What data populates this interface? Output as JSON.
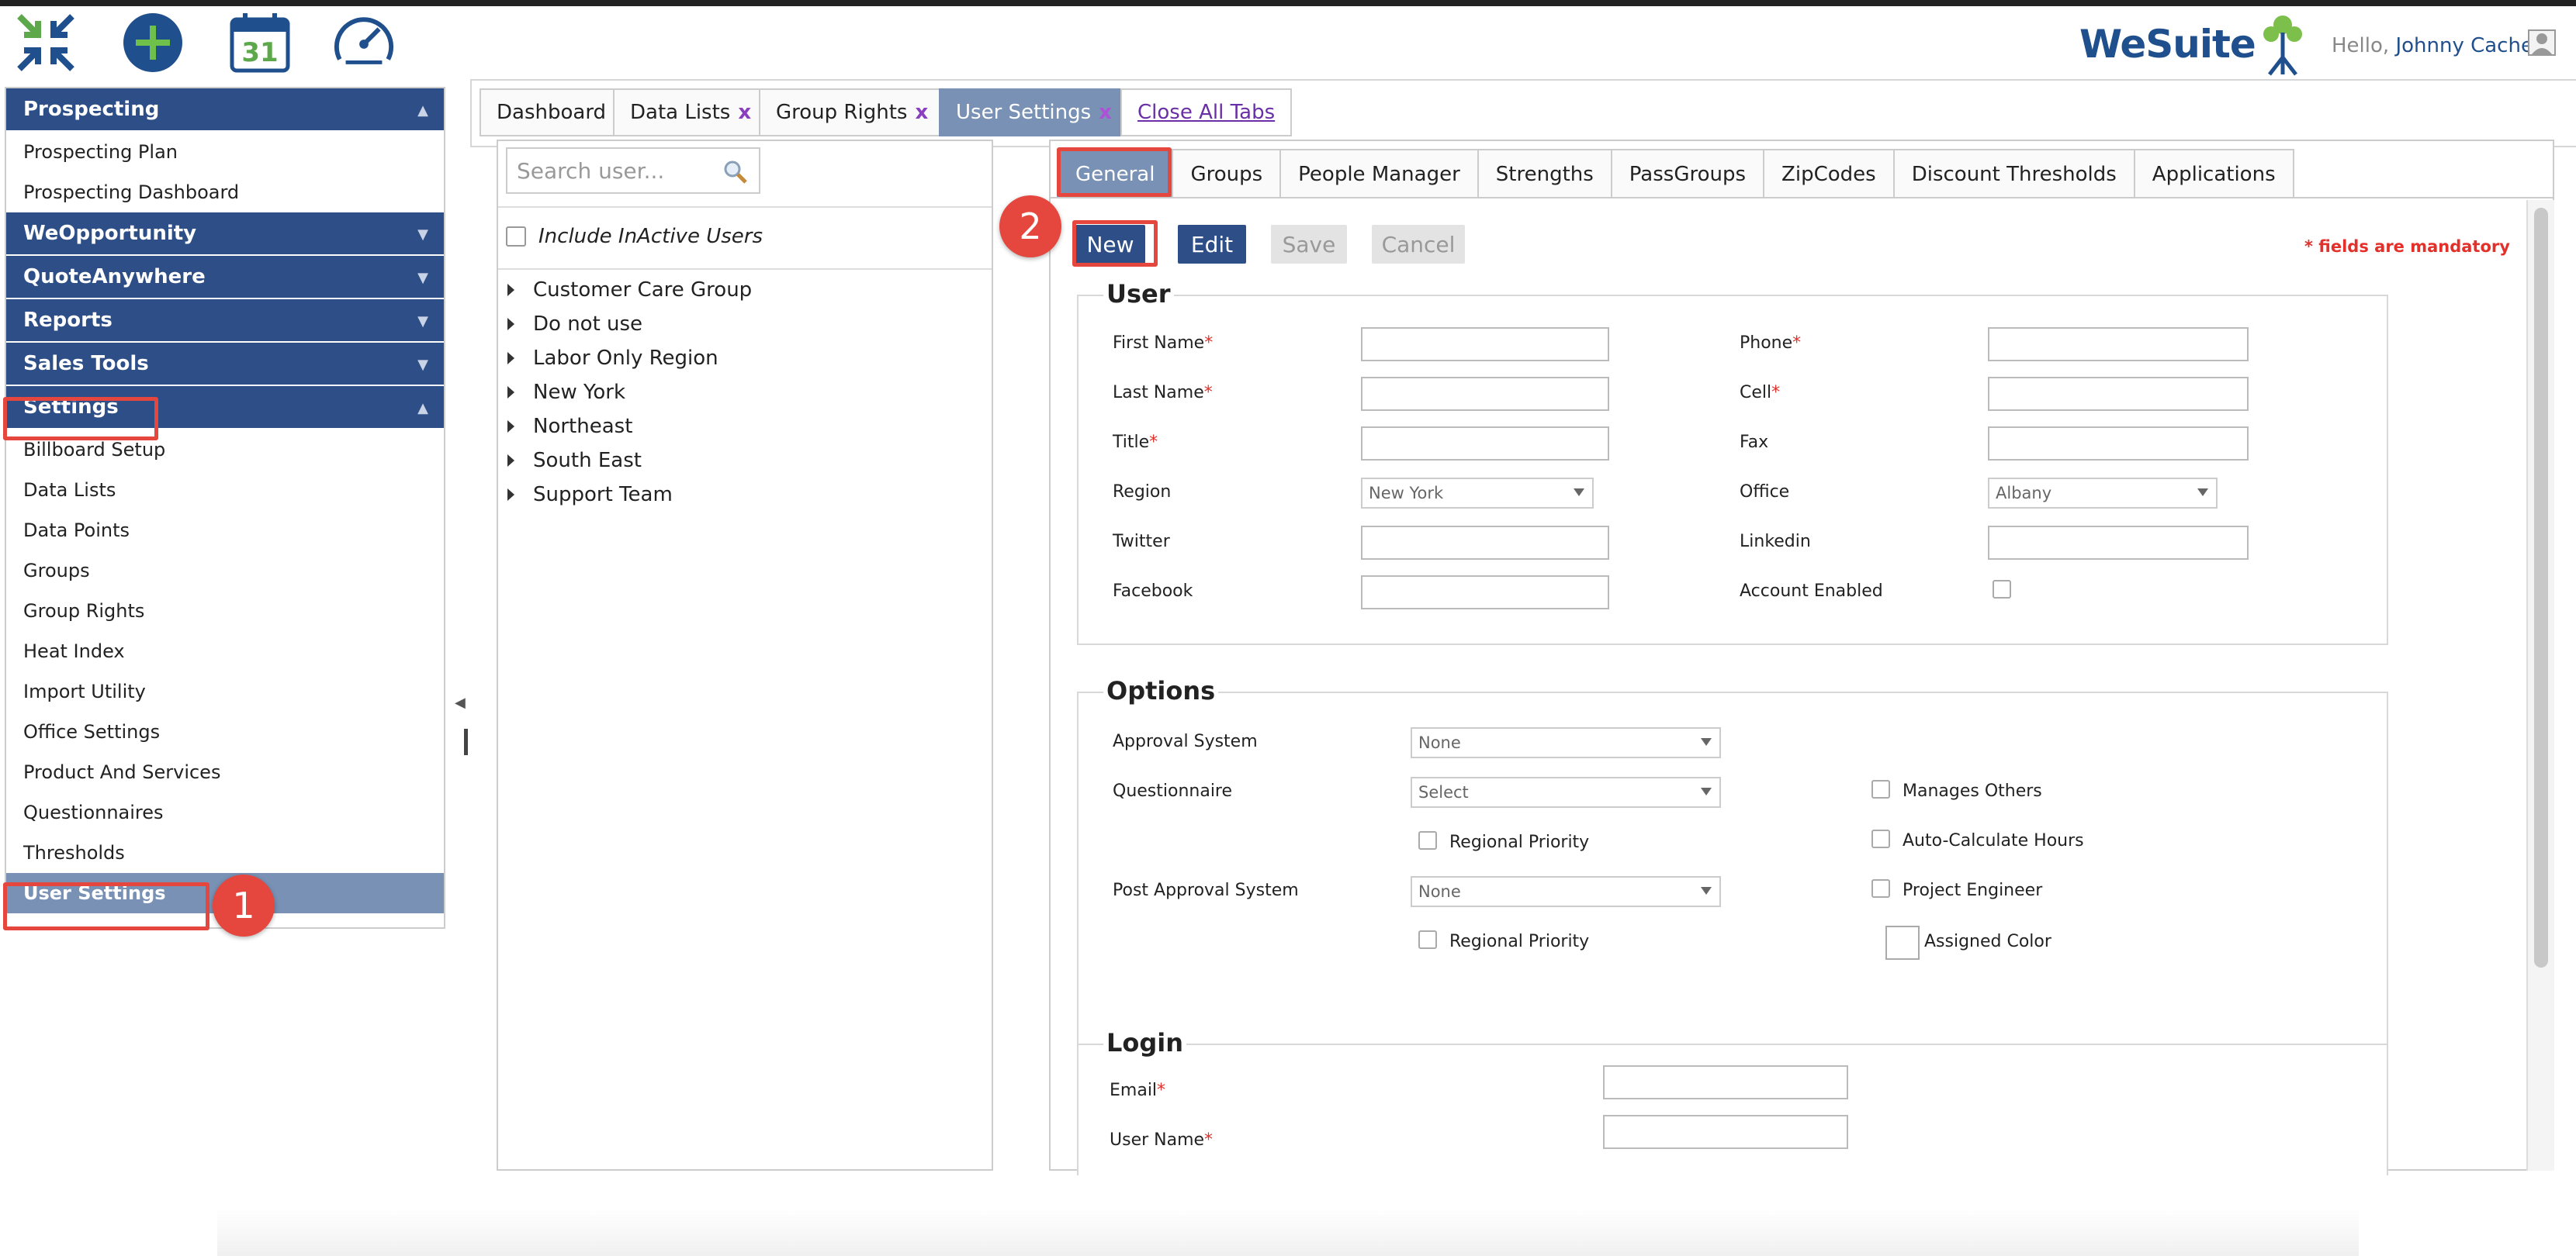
{
  "header": {
    "icons": [
      "collapse-arrows-icon",
      "add-circle-icon",
      "calendar-icon",
      "speedometer-icon"
    ],
    "calendar_day": "31",
    "brand": "WeSuite",
    "greeting": "Hello,",
    "user_name": "Johnny Cache"
  },
  "sidebar": {
    "sections": [
      {
        "label": "Prospecting",
        "items": [
          "Prospecting Plan",
          "Prospecting Dashboard"
        ]
      },
      {
        "label": "WeOpportunity",
        "items": []
      },
      {
        "label": "QuoteAnywhere",
        "items": []
      },
      {
        "label": "Reports",
        "items": []
      },
      {
        "label": "Sales Tools",
        "items": []
      },
      {
        "label": "Settings",
        "items": [
          "Billboard Setup",
          "Data Lists",
          "Data Points",
          "Groups",
          "Group Rights",
          "Heat Index",
          "Import Utility",
          "Office Settings",
          "Product And Services",
          "Questionnaires",
          "Thresholds",
          "User Settings"
        ]
      }
    ]
  },
  "annotations": {
    "step1": "1",
    "step2": "2"
  },
  "tabs": {
    "items": [
      "Dashboard",
      "Data Lists",
      "Group Rights",
      "User Settings"
    ],
    "close_mark": "x",
    "close_all": "Close All Tabs"
  },
  "userlist": {
    "search_placeholder": "Search user...",
    "include_inactive": "Include InActive Users",
    "groups": [
      "Customer Care Group",
      "Do not use",
      "Labor Only Region",
      "New York",
      "Northeast",
      "South East",
      "Support Team"
    ]
  },
  "subtabs": [
    "General",
    "Groups",
    "People Manager",
    "Strengths",
    "PassGroups",
    "ZipCodes",
    "Discount Thresholds",
    "Applications"
  ],
  "actions": {
    "new": "New",
    "edit": "Edit",
    "save": "Save",
    "cancel": "Cancel"
  },
  "mandatory_note": "* fields are mandatory",
  "user_section": {
    "legend": "User",
    "first_name": "First Name",
    "last_name": "Last Name",
    "title": "Title",
    "region": "Region",
    "region_value": "New York",
    "twitter": "Twitter",
    "facebook": "Facebook",
    "phone": "Phone",
    "cell": "Cell",
    "fax": "Fax",
    "office": "Office",
    "office_value": "Albany",
    "linkedin": "Linkedin",
    "account_enabled": "Account Enabled",
    "required_mark": "*"
  },
  "options_section": {
    "legend": "Options",
    "approval_system": "Approval System",
    "approval_value": "None",
    "questionnaire": "Questionnaire",
    "questionnaire_value": "Select",
    "regional_priority": "Regional Priority",
    "post_approval": "Post Approval System",
    "post_approval_value": "None",
    "manages_others": "Manages Others",
    "auto_calc": "Auto-Calculate Hours",
    "project_engineer": "Project Engineer",
    "assigned_color": "Assigned Color"
  },
  "login_section": {
    "legend": "Login",
    "email": "Email",
    "username": "User Name"
  },
  "colors": {
    "nav_blue": "#2e4e87",
    "active_tab": "#7891b4",
    "highlight_red": "#e5463d",
    "required_red": "#e3302a"
  }
}
